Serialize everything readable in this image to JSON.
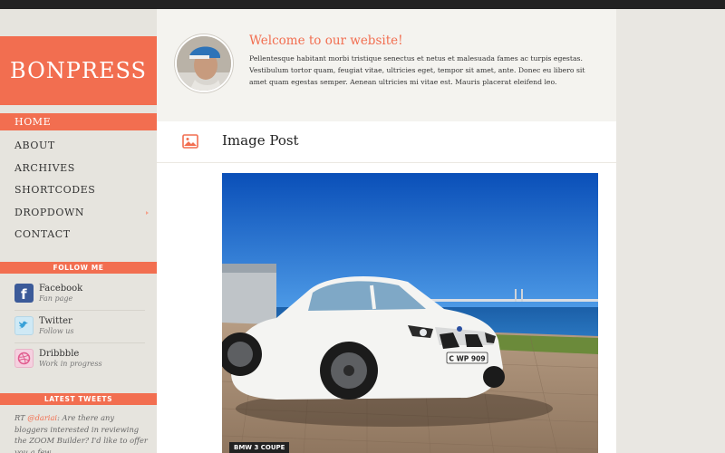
{
  "site": {
    "logo": "BONPRESS"
  },
  "nav": {
    "items": [
      {
        "label": "HOME"
      },
      {
        "label": "ABOUT"
      },
      {
        "label": "ARCHIVES"
      },
      {
        "label": "SHORTCODES"
      },
      {
        "label": "DROPDOWN"
      },
      {
        "label": "CONTACT"
      }
    ]
  },
  "follow": {
    "title": "FOLLOW ME",
    "items": [
      {
        "name": "Facebook",
        "sub": "Fan page",
        "icon": "facebook-icon"
      },
      {
        "name": "Twitter",
        "sub": "Follow us",
        "icon": "twitter-icon"
      },
      {
        "name": "Dribbble",
        "sub": "Work in progress",
        "icon": "dribbble-icon"
      }
    ]
  },
  "tweets": {
    "title": "LATEST TWEETS",
    "rt": "RT ",
    "mention": "@dariai",
    "text": ": Are there any bloggers interested in reviewing the ZOOM Builder? I'd like to offer you a few"
  },
  "welcome": {
    "title": "Welcome to our website!",
    "text": "Pellentesque habitant morbi tristique senectus et netus et malesuada fames ac turpis egestas. Vestibulum tortor quam, feugiat vitae, ultricies eget, tempor sit amet, ante. Donec eu libero sit amet quam egestas semper. Aenean ultricies mi vitae est. Mauris placerat eleifend leo."
  },
  "post": {
    "title": "Image Post",
    "caption": "BMW 3 COUPE",
    "plate": "C WP 909",
    "icon": "image-icon"
  },
  "colors": {
    "accent": "#f26e50",
    "topbar": "#222222",
    "sidebar": "#e6e4de"
  }
}
